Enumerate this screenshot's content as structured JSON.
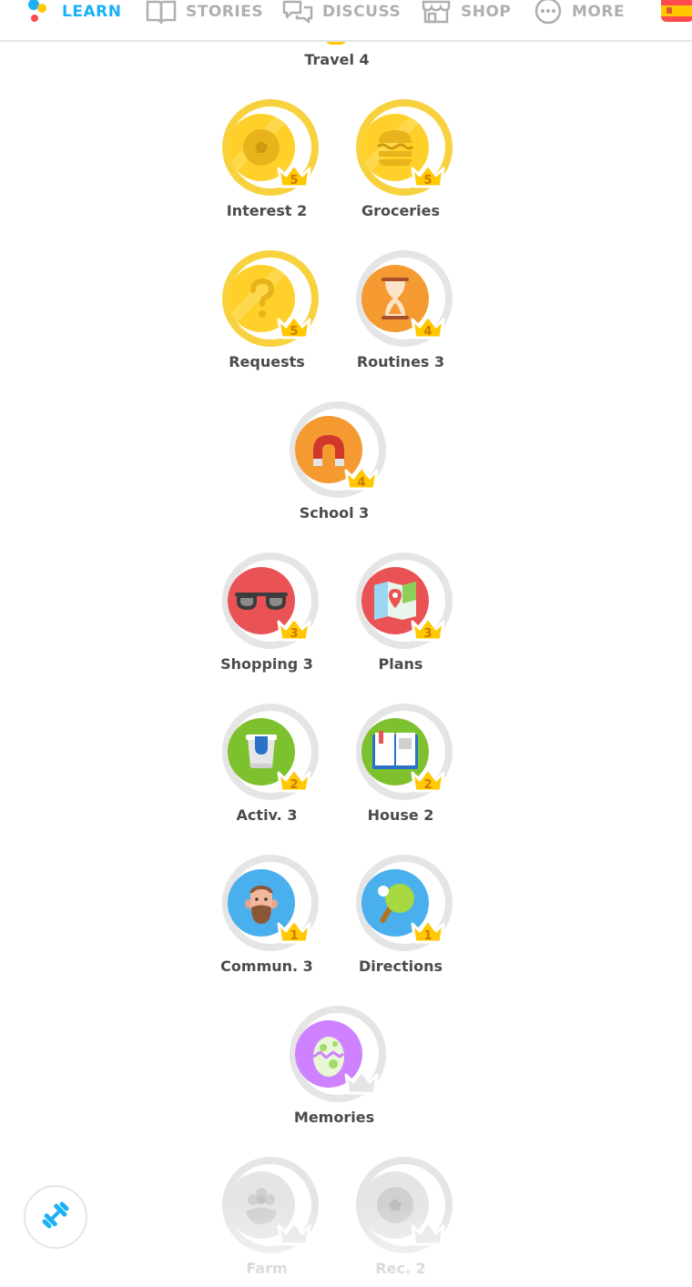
{
  "nav": {
    "learn": "LEARN",
    "stories": "STORIES",
    "discuss": "DISCUSS",
    "shop": "SHOP",
    "more": "MORE",
    "flag_icon": "spain-flag-icon"
  },
  "colors": {
    "accent": "#1cb0f6",
    "gold": "#ffc800",
    "gold_ring": "#f7d23e",
    "gray_ring": "#e5e5e5",
    "text": "#4b4b4b"
  },
  "top_skill": {
    "label": "Travel 4"
  },
  "skills": [
    {
      "name": "Interest 2",
      "crown": "5",
      "icon": "soccer-ball-icon",
      "status": "gold"
    },
    {
      "name": "Groceries",
      "crown": "5",
      "icon": "burger-icon",
      "status": "gold"
    },
    {
      "name": "Requests",
      "crown": "5",
      "icon": "question-icon",
      "status": "gold"
    },
    {
      "name": "Routines 3",
      "crown": "4",
      "icon": "hourglass-icon",
      "status": "orange"
    },
    {
      "name": "School 3",
      "crown": "4",
      "icon": "magnet-icon",
      "status": "orange"
    },
    {
      "name": "Shopping 3",
      "crown": "3",
      "icon": "sunglasses-icon",
      "status": "red"
    },
    {
      "name": "Plans",
      "crown": "3",
      "icon": "map-icon",
      "status": "red"
    },
    {
      "name": "Activ. 3",
      "crown": "2",
      "icon": "paint-bucket-icon",
      "status": "green"
    },
    {
      "name": "House 2",
      "crown": "2",
      "icon": "book-icon",
      "status": "green"
    },
    {
      "name": "Commun. 3",
      "crown": "1",
      "icon": "bearded-man-icon",
      "status": "blue"
    },
    {
      "name": "Directions",
      "crown": "1",
      "icon": "ping-pong-icon",
      "status": "blue"
    },
    {
      "name": "Memories",
      "crown": "",
      "icon": "egg-icon",
      "status": "purple"
    },
    {
      "name": "Farm",
      "crown": "",
      "icon": "flower-icon",
      "status": "locked"
    },
    {
      "name": "Rec. 2",
      "crown": "",
      "icon": "soccer-ball-icon",
      "status": "locked"
    }
  ],
  "practice_button": {
    "icon": "dumbbell-icon"
  }
}
